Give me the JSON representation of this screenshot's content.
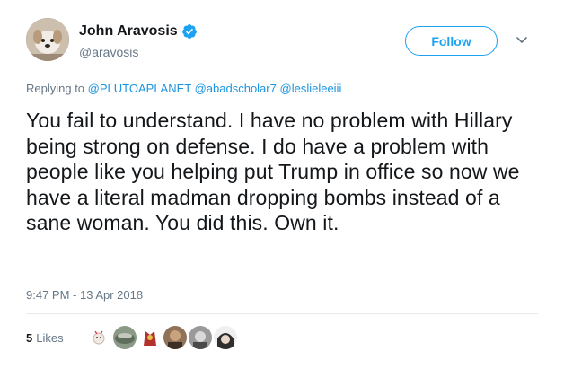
{
  "author": {
    "display_name": "John Aravosis",
    "handle": "@aravosis",
    "verified": true
  },
  "follow_button": {
    "label": "Follow"
  },
  "reply": {
    "prefix": "Replying to",
    "mentions": [
      "@PLUTOAPLANET",
      "@abadscholar7",
      "@leslieleeiii"
    ]
  },
  "tweet": {
    "text": "You fail to understand. I have no problem with Hillary being strong on defense. I do have a problem with people like you helping put Trump in office so now we have a literal madman dropping bombs instead of a sane woman. You did this. Own it."
  },
  "timestamp": "9:47 PM - 13 Apr 2018",
  "stats": {
    "likes_count": "5",
    "likes_label": "Likes"
  },
  "colors": {
    "accent": "#1da1f2",
    "mention": "#1b95e0",
    "muted": "#657786",
    "text": "#14171a"
  },
  "icons": {
    "verified": "verified-badge-icon",
    "caret": "chevron-down-icon"
  }
}
